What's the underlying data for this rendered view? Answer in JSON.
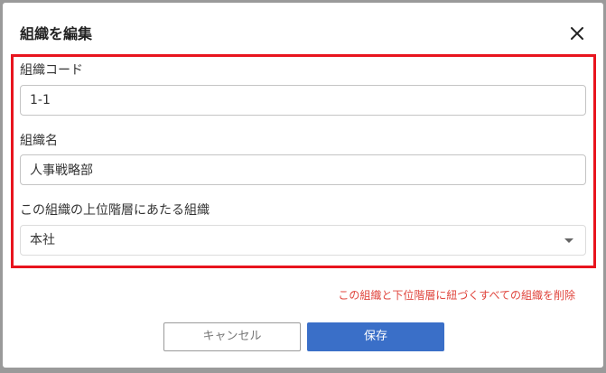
{
  "dialog": {
    "title": "組織を編集",
    "close_icon": "close-icon",
    "highlight_color": "#e8141e"
  },
  "form": {
    "org_code": {
      "label": "組織コード",
      "value": "1-1"
    },
    "org_name": {
      "label": "組織名",
      "value": "人事戦略部"
    },
    "parent_org": {
      "label": "この組織の上位階層にあたる組織",
      "selected": "本社",
      "caret_icon": "caret-down-icon"
    }
  },
  "delete_link": {
    "label": "この組織と下位階層に紐づくすべての組織を削除",
    "color": "#e0463e"
  },
  "buttons": {
    "cancel_label": "キャンセル",
    "save_label": "保存",
    "save_color": "#3a6fc8"
  }
}
